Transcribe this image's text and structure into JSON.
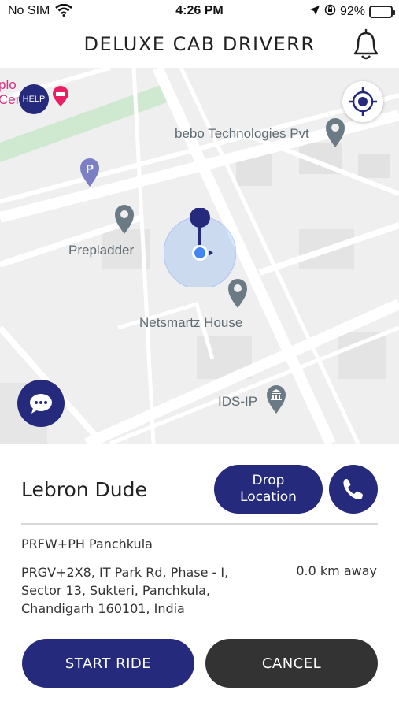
{
  "status_bar": {
    "carrier": "No SIM",
    "time": "4:26 PM",
    "battery": "92%",
    "battery_level": 0.92,
    "icons": [
      "wifi-icon",
      "location-arrow-icon",
      "orientation-lock-icon",
      "battery-charging-icon"
    ]
  },
  "header": {
    "title": "DELUXE CAB DRIVERR",
    "notification_icon": "bell-icon"
  },
  "map": {
    "help_label": "HELP",
    "partial_label": "plo\nCen",
    "pois": [
      {
        "name": "bebo Technologies Pvt",
        "icon": "map-pin-icon"
      },
      {
        "name": "Prepladder",
        "icon": "map-pin-icon"
      },
      {
        "name": "Netsmartz House",
        "icon": "map-pin-icon"
      },
      {
        "name": "IDS-IP",
        "icon": "institution-icon"
      }
    ],
    "parking_icon": "parking-icon",
    "hotel_icon": "hotel-icon",
    "recenter_icon": "target-icon",
    "chat_icon": "chat-bubble-icon"
  },
  "ride": {
    "rider_name": "Lebron Dude",
    "drop_location_label": "Drop\nLocation",
    "call_icon": "phone-icon",
    "pickup_code": "PRFW+PH Panchkula",
    "address": "PRGV+2X8, IT Park Rd, Phase - I, Sector 13, Sukteri, Panchkula, Chandigarh 160101, India",
    "distance": "0.0 km away",
    "start_label": "START RIDE",
    "cancel_label": "CANCEL"
  },
  "colors": {
    "primary": "#252a7d",
    "cancel": "#333333",
    "map_bg": "#eeeeee",
    "park": "#c8e6c9",
    "pin": "#6b7b85",
    "location_dot": "#4285f4",
    "hotel": "#e91e63"
  }
}
